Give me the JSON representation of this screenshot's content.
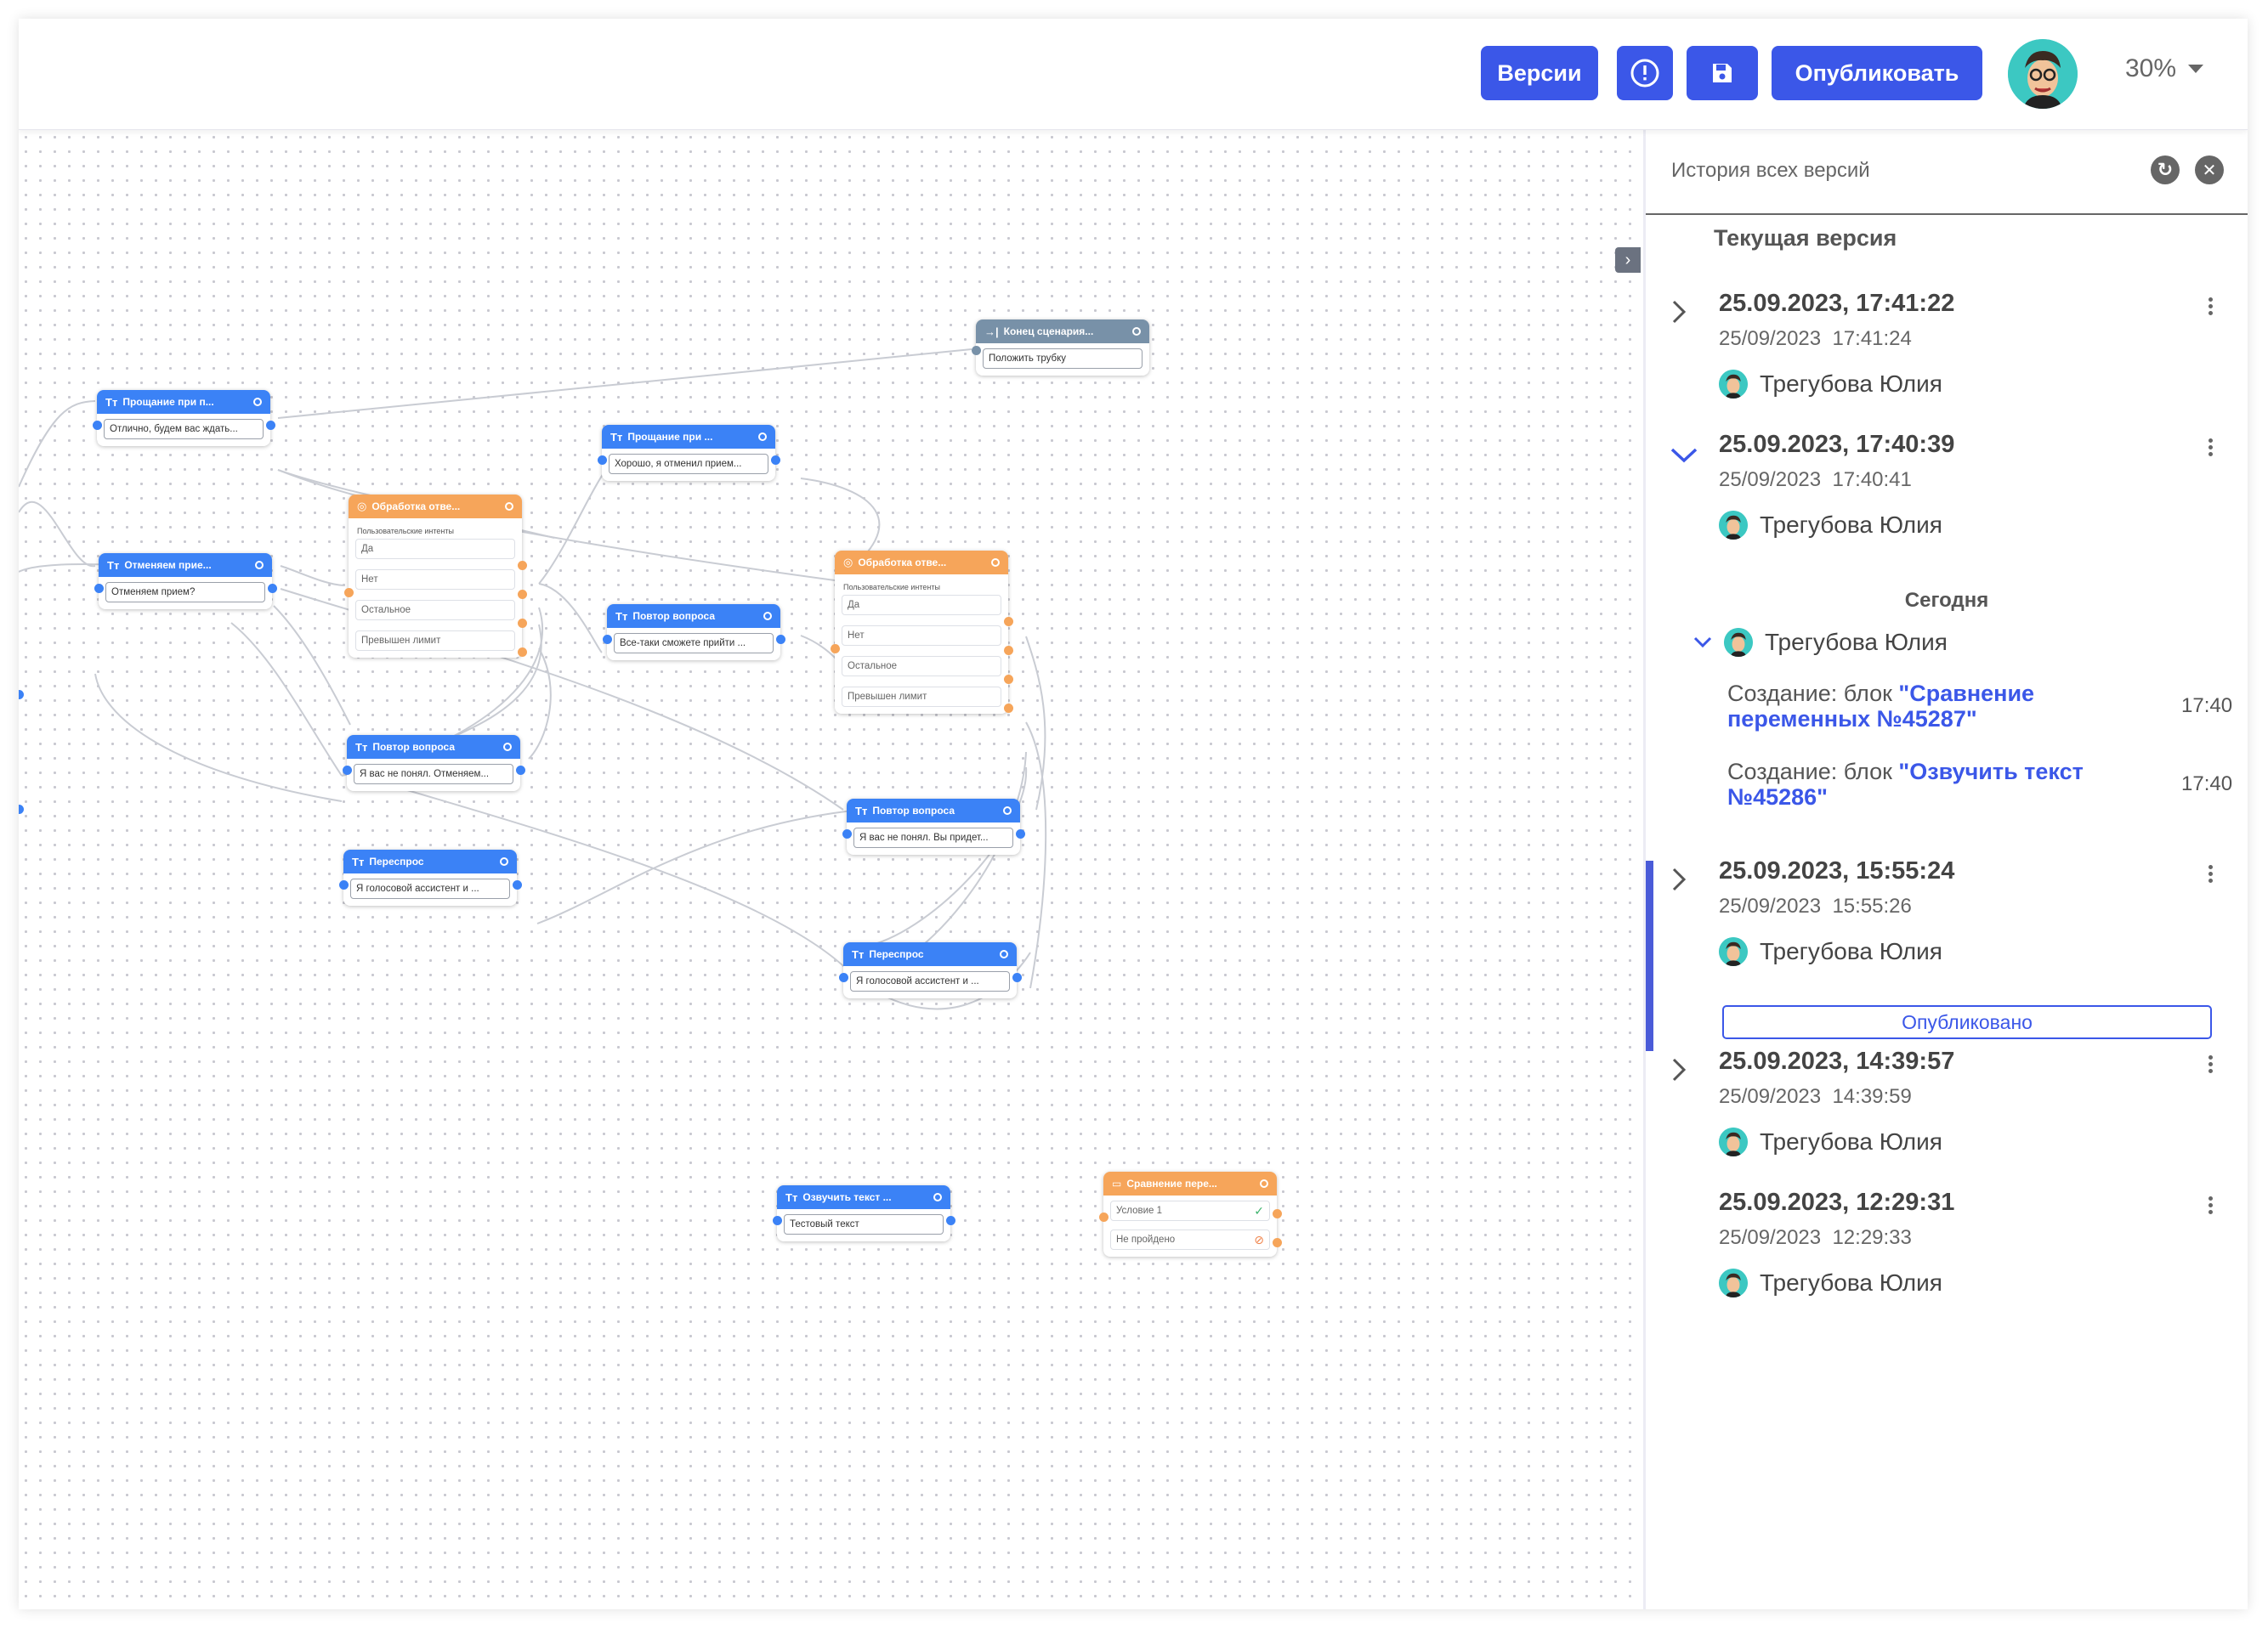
{
  "header": {
    "versions_label": "Версии",
    "info_icon": "exclamation-circle-icon",
    "save_icon": "floppy-disk-icon",
    "publish_label": "Опубликовать",
    "zoom": "30%"
  },
  "canvas": {
    "nodes": [
      {
        "title": "Прощание при п...",
        "text": "Отлично, будем вас ждать..."
      },
      {
        "title": "Прощание при ...",
        "text": "Хорошо, я отменил прием..."
      },
      {
        "title": "Конец сценария...",
        "text": "Положить трубку"
      },
      {
        "title": "Отменяем прие...",
        "text": "Отменяем прием?"
      },
      {
        "title": "Обработка отве...",
        "sub": "Пользовательские интенты",
        "rows": [
          "Да",
          "Нет",
          "Остальное",
          "Превышен лимит"
        ]
      },
      {
        "title": "Повтор вопроса",
        "text": "Все-таки сможете прийти ..."
      },
      {
        "title": "Обработка отве...",
        "sub": "Пользовательские интенты",
        "rows": [
          "Да",
          "Нет",
          "Остальное",
          "Превышен лимит"
        ]
      },
      {
        "title": "Повтор вопроса",
        "text": "Я вас не понял. Отменяем..."
      },
      {
        "title": "Переспрос",
        "text": "Я голосовой ассистент и ..."
      },
      {
        "title": "Повтор вопроса",
        "text": "Я вас не понял. Вы придет..."
      },
      {
        "title": "Переспрос",
        "text": "Я голосовой ассистент и ..."
      },
      {
        "title": "Озвучить текст ...",
        "text": "Тестовый текст"
      },
      {
        "title": "Сравнение пере...",
        "rows": [
          "Условие 1",
          "Не пройдено"
        ]
      }
    ]
  },
  "panel": {
    "title": "История всех версий",
    "current_version": "Текущая версия",
    "versions": [
      {
        "title": "25.09.2023, 17:41:22",
        "sub": "25/09/2023  17:41:24",
        "user": "Трегубова Юлия"
      },
      {
        "title": "25.09.2023, 17:40:39",
        "sub": "25/09/2023  17:40:41",
        "user": "Трегубова Юлия"
      },
      {
        "title": "25.09.2023, 15:55:24",
        "sub": "25/09/2023  15:55:26",
        "user": "Трегубова Юлия"
      },
      {
        "title": "25.09.2023, 14:39:57",
        "sub": "25/09/2023  14:39:59",
        "user": "Трегубова Юлия"
      },
      {
        "title": "25.09.2023, 12:29:31",
        "sub": "25/09/2023  12:29:33",
        "user": "Трегубова Юлия"
      }
    ],
    "today_label": "Сегодня",
    "today_user": "Трегубова Юлия",
    "changes": [
      {
        "prefix": "Создание: блок ",
        "block": "\"Сравнение переменных №45287\"",
        "time": "17:40"
      },
      {
        "prefix": "Создание: блок ",
        "block": "\"Озвучить текст №45286\"",
        "time": "17:40"
      }
    ],
    "published_label": "Опубликовано"
  }
}
